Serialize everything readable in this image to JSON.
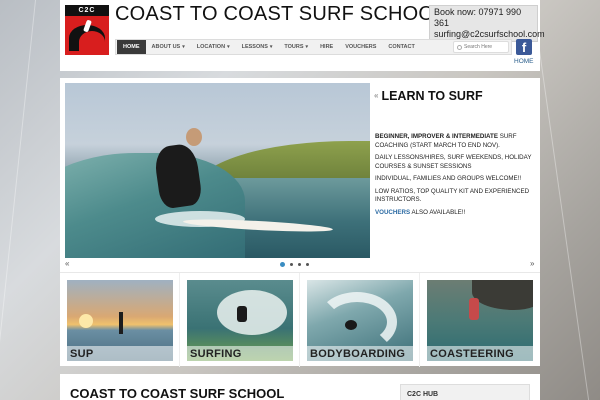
{
  "header": {
    "logo_text": "C2C",
    "title": "COAST TO COAST SURF SCHOOL",
    "book_now": "Book now: 07971 990 361",
    "email": "surfing@c2csurfschool.com",
    "home_link": "HOME",
    "facebook_icon": "facebook-icon"
  },
  "nav": {
    "items": [
      {
        "label": "HOME",
        "active": true,
        "dropdown": false
      },
      {
        "label": "ABOUT US",
        "active": false,
        "dropdown": true
      },
      {
        "label": "LOCATION",
        "active": false,
        "dropdown": true
      },
      {
        "label": "LESSONS",
        "active": false,
        "dropdown": true
      },
      {
        "label": "TOURS",
        "active": false,
        "dropdown": true
      },
      {
        "label": "HIRE",
        "active": false,
        "dropdown": false
      },
      {
        "label": "VOUCHERS",
        "active": false,
        "dropdown": false
      },
      {
        "label": "CONTACT",
        "active": false,
        "dropdown": false
      }
    ],
    "search_placeholder": "Search Here"
  },
  "slider": {
    "title": "LEARN TO SURF",
    "quote_mark": "«",
    "p1_bold": "BEGINNER, IMPROVER & INTERMEDIATE",
    "p1_rest": " SURF COACHING (START MARCH TO END NOV).",
    "p2": "DAILY LESSONS/HIRES, SURF WEEKENDS, HOLIDAY COURSES & SUNSET SESSIONS",
    "p3": "INDIVIDUAL, FAMILIES AND GROUPS WELCOME!!",
    "p4": "LOW RATIOS, TOP QUALITY KIT AND EXPERIENCED INSTRUCTORS.",
    "p5_link": "VOUCHERS",
    "p5_rest": " ALSO AVAILABLE!!",
    "prev_arrow": "«",
    "next_arrow": "»",
    "slide_count": 4,
    "active_slide": 1
  },
  "tiles": [
    {
      "label": "SUP",
      "kind": "sup"
    },
    {
      "label": "SURFING",
      "kind": "surf"
    },
    {
      "label": "BODYBOARDING",
      "kind": "body"
    },
    {
      "label": "COASTEERING",
      "kind": "coast"
    }
  ],
  "bottom": {
    "title": "COAST TO COAST SURF SCHOOL",
    "hub_title": "C2C HUB"
  },
  "colors": {
    "accent_blue": "#2b6aa3",
    "nav_active": "#3a3a3a",
    "logo_red": "#d81e1e",
    "facebook": "#3b5998"
  }
}
